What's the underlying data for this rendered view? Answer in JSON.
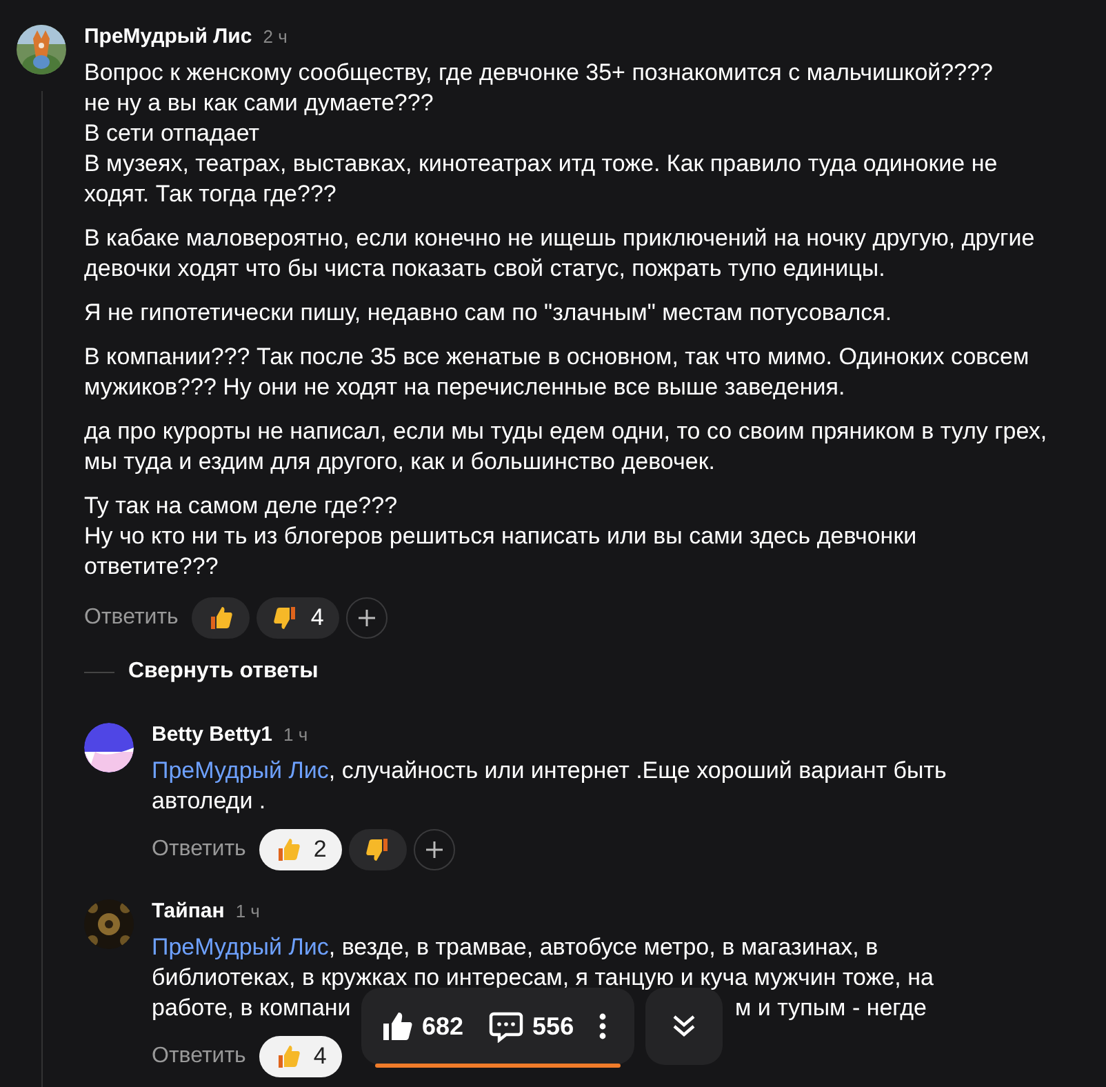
{
  "comment": {
    "author": "ПреМудрый Лис",
    "time": "2 ч",
    "avatar": {
      "kind": "picture"
    },
    "paragraphs": [
      [
        "Вопрос к женскому сообществу, где девчонке 35+ познакомится с мальчишкой????",
        "не ну а вы как сами думаете???",
        "В сети отпадает",
        "В музеях, театрах, выставках, кинотеатрах итд тоже. Как правило туда одинокие не ходят. Так тогда где???"
      ],
      [
        "В кабаке маловероятно, если конечно не ищешь приключений на ночку другую, другие девочки ходят что бы чиста показать свой статус, пожрать тупо единицы."
      ],
      [
        "Я не гипотетически пишу, недавно сам по \"злачным\" местам потусовался."
      ],
      [
        "В компании??? Так после 35 все женатые в основном, так что мимо. Одиноких совсем мужиков??? Ну они не ходят на перечисленные все выше заведения."
      ],
      [
        "да про курорты не написал, если мы туды едем одни, то со своим пряником в тулу грех, мы туда и ездим для другого, как и большинство девочек."
      ],
      [
        "Ту так на самом деле где???",
        "Ну чо кто ни ть из блогеров решиться написать или вы сами здесь девчонки ответите???"
      ]
    ],
    "reply_label": "Ответить",
    "reactions": [
      {
        "kind": "like",
        "selected": false
      },
      {
        "kind": "dislike",
        "count": "4",
        "selected": false
      },
      {
        "kind": "add"
      }
    ]
  },
  "collapse_label": "Свернуть ответы",
  "replies": [
    {
      "author": "Betty Betty1",
      "time": "1 ч",
      "avatar": {
        "kind": "logo"
      },
      "mention": "ПреМудрый Лис",
      "lines": [
        ", случайность или интернет .Еще хороший вариант быть",
        "автоледи ."
      ],
      "reply_label": "Ответить",
      "reactions": [
        {
          "kind": "like",
          "count": "2",
          "selected": true
        },
        {
          "kind": "dislike",
          "selected": false
        },
        {
          "kind": "add"
        }
      ]
    },
    {
      "author": "Тайпан",
      "time": "1 ч",
      "avatar": {
        "kind": "picture"
      },
      "mention": "ПреМудрый Лис",
      "lines": [
        ", везде, в трамвае, автобусе метро, в магазинах, в",
        "библиотеках, в кружках по интересам, я танцую и куча мужчин тоже, на",
        [
          "работе, в компани",
          "м и тупым - негде"
        ]
      ],
      "reply_label": "Ответить",
      "reactions": [
        {
          "kind": "like",
          "count": "4",
          "selected": true
        }
      ]
    }
  ],
  "floating_bar": {
    "likes": "682",
    "comments": "556"
  }
}
